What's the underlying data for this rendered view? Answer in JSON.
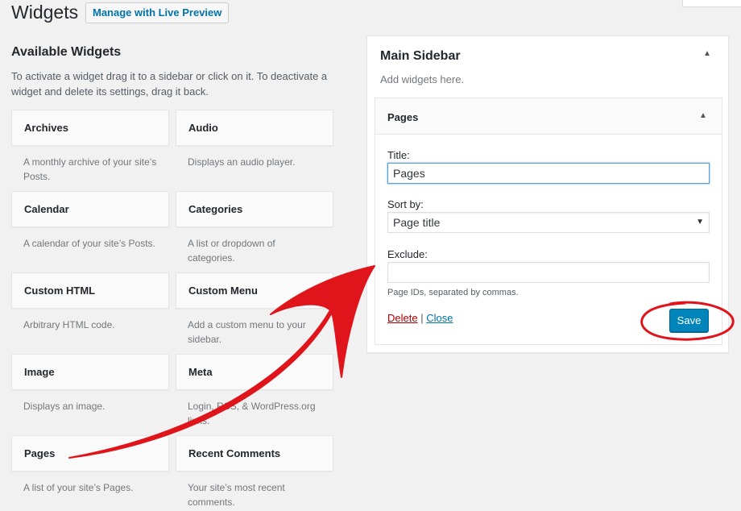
{
  "page": {
    "title": "Widgets",
    "live_preview_label": "Manage with Live Preview"
  },
  "available": {
    "title": "Available Widgets",
    "description": "To activate a widget drag it to a sidebar or click on it. To deactivate a widget and delete its settings, drag it back.",
    "widgets": [
      {
        "title": "Archives",
        "desc": "A monthly archive of your site’s Posts."
      },
      {
        "title": "Audio",
        "desc": "Displays an audio player."
      },
      {
        "title": "Calendar",
        "desc": "A calendar of your site’s Posts."
      },
      {
        "title": "Categories",
        "desc": "A list or dropdown of categories."
      },
      {
        "title": "Custom HTML",
        "desc": "Arbitrary HTML code."
      },
      {
        "title": "Custom Menu",
        "desc": "Add a custom menu to your sidebar."
      },
      {
        "title": "Image",
        "desc": "Displays an image."
      },
      {
        "title": "Meta",
        "desc": "Login, RSS, & WordPress.org links."
      },
      {
        "title": "Pages",
        "desc": "A list of your site’s Pages."
      },
      {
        "title": "Recent Comments",
        "desc": "Your site’s most recent comments."
      }
    ]
  },
  "sidebar": {
    "title": "Main Sidebar",
    "hint": "Add widgets here.",
    "toggle_icon": "▲"
  },
  "pages_widget": {
    "title": "Pages",
    "toggle_icon": "▲",
    "title_label": "Title:",
    "title_value": "Pages",
    "sort_label": "Sort by:",
    "sort_value": "Page title",
    "sort_arrow": "▼",
    "exclude_label": "Exclude:",
    "exclude_value": "",
    "help_text": "Page IDs, separated by commas.",
    "delete_label": "Delete",
    "separator": "|",
    "close_label": "Close",
    "save_label": "Save"
  },
  "annotations": {
    "arrow_color": "#e0141b",
    "circle_color": "#e0141b"
  }
}
